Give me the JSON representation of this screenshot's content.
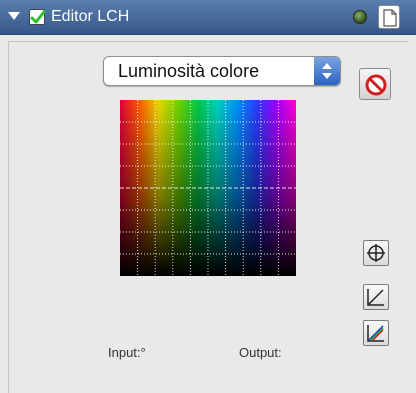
{
  "window": {
    "title": "Editor LCH",
    "enabled": true
  },
  "mode_select": {
    "value": "Luminosità colore"
  },
  "readouts": {
    "input_label": "Input:°",
    "output_label": "Output:"
  },
  "icons": {
    "disclosure": "disclosure-triangle-icon",
    "checkbox": "checkmark-icon",
    "status": "status-dot-icon",
    "document": "document-icon",
    "reset": "no-entry-icon",
    "picker": "crosshair-icon",
    "curve_linear": "curve-linear-icon",
    "curve_color": "curve-color-icon"
  },
  "colors": {
    "titlebar": "#4a6da0",
    "check_green": "#2fbf2f",
    "reset_red": "#d11f1f",
    "select_accent": "#2c63c4"
  },
  "grid": {
    "columns": 10,
    "rows": 8,
    "hues": [
      "#e0003a",
      "#ff5a00",
      "#e8d800",
      "#6fd400",
      "#00c84a",
      "#00d0c0",
      "#0090ff",
      "#2a3cff",
      "#a000ff",
      "#ff00d0"
    ]
  }
}
